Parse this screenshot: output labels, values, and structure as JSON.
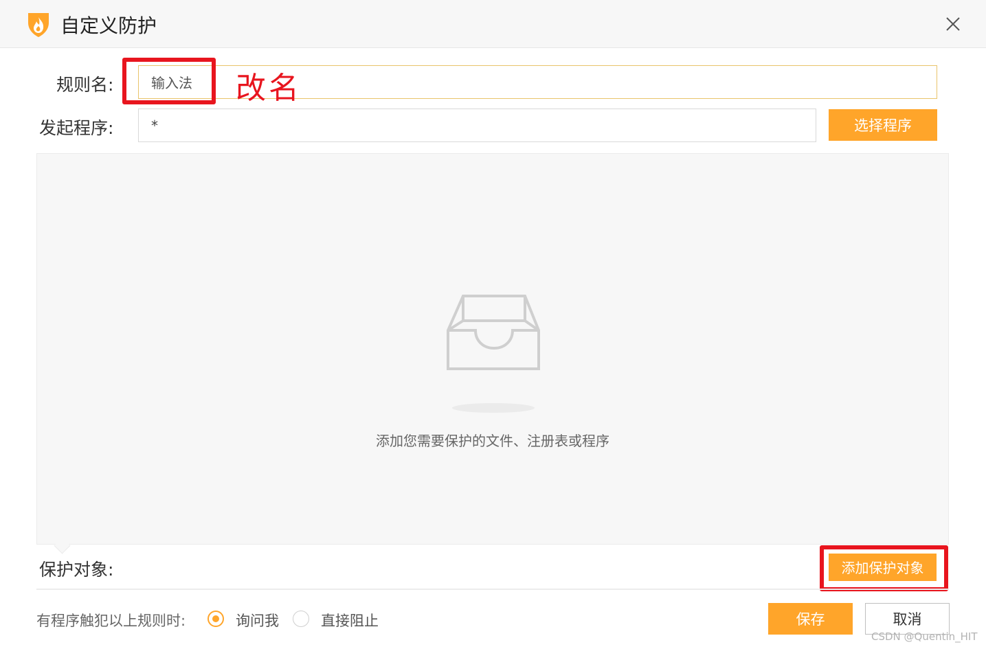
{
  "window": {
    "title": "自定义防护",
    "close_icon": "close-icon"
  },
  "form": {
    "rule_name_label": "规则名:",
    "rule_name_value": "输入法",
    "launcher_label": "发起程序:",
    "launcher_value": "*",
    "select_program_button": "选择程序"
  },
  "annotation": {
    "text": "改名",
    "color": "#e8151e"
  },
  "empty_state": {
    "icon": "inbox-icon",
    "message": "添加您需要保护的文件、注册表或程序"
  },
  "protect": {
    "label": "保护对象:",
    "add_button": "添加保护对象"
  },
  "trigger": {
    "label": "有程序触犯以上规则时:",
    "options": [
      {
        "label": "询问我",
        "selected": true
      },
      {
        "label": "直接阻止",
        "selected": false
      }
    ]
  },
  "actions": {
    "save": "保存",
    "cancel": "取消"
  },
  "watermark": "CSDN @Quentin_HIT",
  "colors": {
    "accent": "#ffa52a",
    "highlight": "#e8151e"
  }
}
